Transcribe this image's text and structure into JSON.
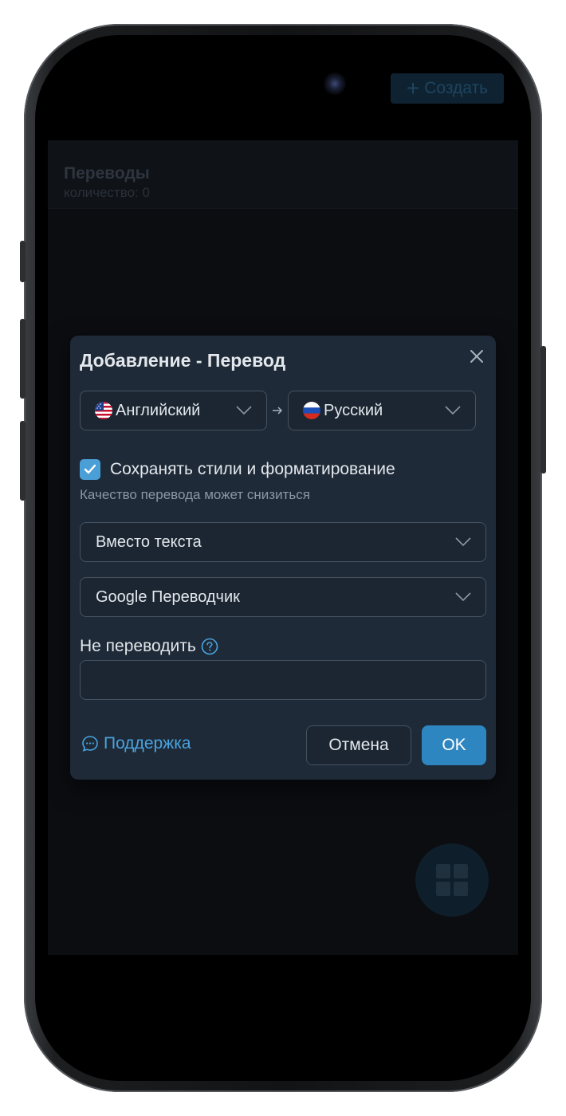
{
  "background_app": {
    "title": "Переводы",
    "count_label": "количество: 0",
    "create_button": {
      "icon": "plus-icon",
      "label": "Создать"
    },
    "fab_icon": "grid-icon"
  },
  "dialog": {
    "title": "Добавление - Перевод",
    "close_icon": "close-icon",
    "source_language": {
      "flag": "us-flag-icon",
      "label": "Английский"
    },
    "target_language": {
      "flag": "ru-flag-icon",
      "label": "Русский"
    },
    "direction_icon": "arrow-right-icon",
    "preserve_styles": {
      "checked": true,
      "label": "Сохранять стили и форматирование",
      "hint": "Качество перевода может снизиться"
    },
    "placement_select": {
      "value": "Вместо текста"
    },
    "engine_select": {
      "value": "Google Переводчик"
    },
    "do_not_translate": {
      "label": "Не переводить",
      "help_icon": "help-circle-icon",
      "value": "",
      "placeholder": ""
    },
    "support_link": {
      "icon": "chat-bubble-icon",
      "label": "Поддержка"
    },
    "cancel_button": "Отмена",
    "ok_button": "OK"
  },
  "colors": {
    "dialog_bg": "#1e2a37",
    "accent": "#2e86c1",
    "link": "#4aa3e0",
    "text": "#e3e7ec",
    "muted": "#8a97a5"
  }
}
